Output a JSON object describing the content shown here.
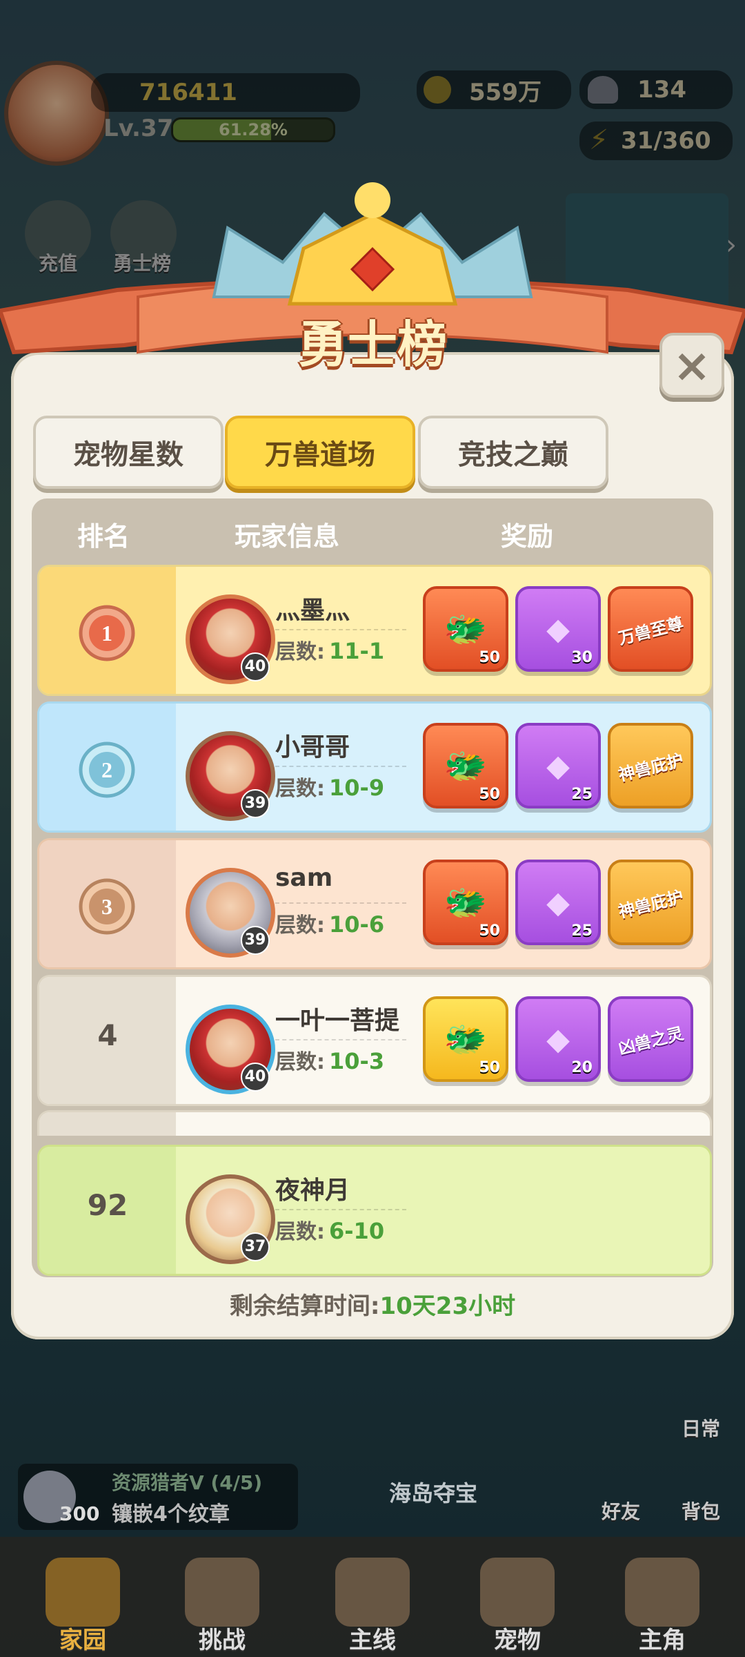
{
  "hud": {
    "power": "716411",
    "level": "Lv.37",
    "exp_percent_text": "61.28%",
    "exp_fraction": 0.6128,
    "coins": "559万",
    "shells": "134",
    "energy": "31/360",
    "side_left": [
      "充值",
      "勇士榜"
    ],
    "task_count": "300",
    "task_title": "资源猎者V (4/5)",
    "task_desc": "镶嵌4个纹章",
    "island_label": "海岛夺宝",
    "right_btns": [
      "日常",
      "好友",
      "背包"
    ]
  },
  "panel": {
    "title": "勇士榜",
    "close_glyph": "×",
    "tabs": [
      "宠物星数",
      "万兽道场",
      "竞技之巅"
    ],
    "active_tab": 1,
    "columns": {
      "rank": "排名",
      "player": "玩家信息",
      "reward": "奖励"
    },
    "floor_label": "层数:",
    "rows": [
      {
        "rank": "1",
        "name": "灬墨灬",
        "level": "40",
        "floor": "11-1",
        "rewards": [
          {
            "kind": "red",
            "count": "50"
          },
          {
            "kind": "purple",
            "count": "30"
          },
          {
            "kind": "red-banner",
            "text": "万兽至尊"
          }
        ]
      },
      {
        "rank": "2",
        "name": "小哥哥",
        "level": "39",
        "floor": "10-9",
        "rewards": [
          {
            "kind": "red",
            "count": "50"
          },
          {
            "kind": "purple",
            "count": "25"
          },
          {
            "kind": "gold-banner",
            "text": "神兽庇护"
          }
        ]
      },
      {
        "rank": "3",
        "name": "sam",
        "level": "39",
        "floor": "10-6",
        "rewards": [
          {
            "kind": "red",
            "count": "50"
          },
          {
            "kind": "purple",
            "count": "25"
          },
          {
            "kind": "gold-banner",
            "text": "神兽庇护"
          }
        ]
      },
      {
        "rank": "4",
        "name": "一叶一菩提",
        "level": "40",
        "floor": "10-3",
        "rewards": [
          {
            "kind": "yellow",
            "count": "50"
          },
          {
            "kind": "purple",
            "count": "20"
          },
          {
            "kind": "purple-banner",
            "text": "凶兽之灵"
          }
        ]
      }
    ],
    "self_row": {
      "rank": "92",
      "name": "夜神月",
      "level": "37",
      "floor": "6-10"
    },
    "settle_label": "剩余结算时间:",
    "settle_value": "10天23小时"
  },
  "nav": [
    "家园",
    "挑战",
    "主线",
    "宠物",
    "主角"
  ]
}
